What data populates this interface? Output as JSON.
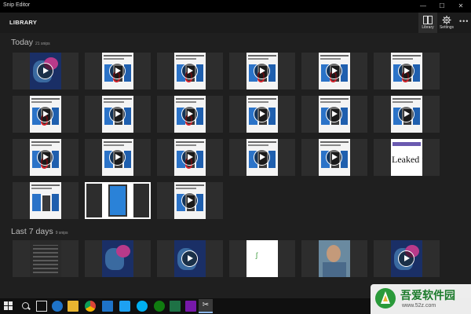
{
  "window": {
    "title": "Snip Editor",
    "controls": {
      "minimize": "—",
      "maximize": "☐",
      "close": "✕"
    }
  },
  "header": {
    "title": "LIBRARY",
    "buttons": [
      {
        "label": "Library",
        "icon": "library-icon",
        "selected": true
      },
      {
        "label": "Settings",
        "icon": "gear-icon",
        "selected": false
      }
    ],
    "more": "•••"
  },
  "sections": [
    {
      "title": "Today",
      "count": "21 snips"
    },
    {
      "title": "Last 7 days",
      "count": "9 snips"
    }
  ],
  "leaked_snip_text": "Leaked flagship",
  "taskbar": {
    "items": [
      "start",
      "search",
      "task-view",
      "edge",
      "file-explorer",
      "chrome",
      "store",
      "twitter",
      "skype",
      "xbox",
      "excel",
      "onenote",
      "snip"
    ]
  },
  "watermark": {
    "name": "吾爱软件园",
    "url": "www.52z.com"
  },
  "colors": {
    "accent_selected": "#2c2c2c",
    "background": "#1f1f1f",
    "play_button": "#ffffff",
    "annotation_red": "#d0202a"
  }
}
